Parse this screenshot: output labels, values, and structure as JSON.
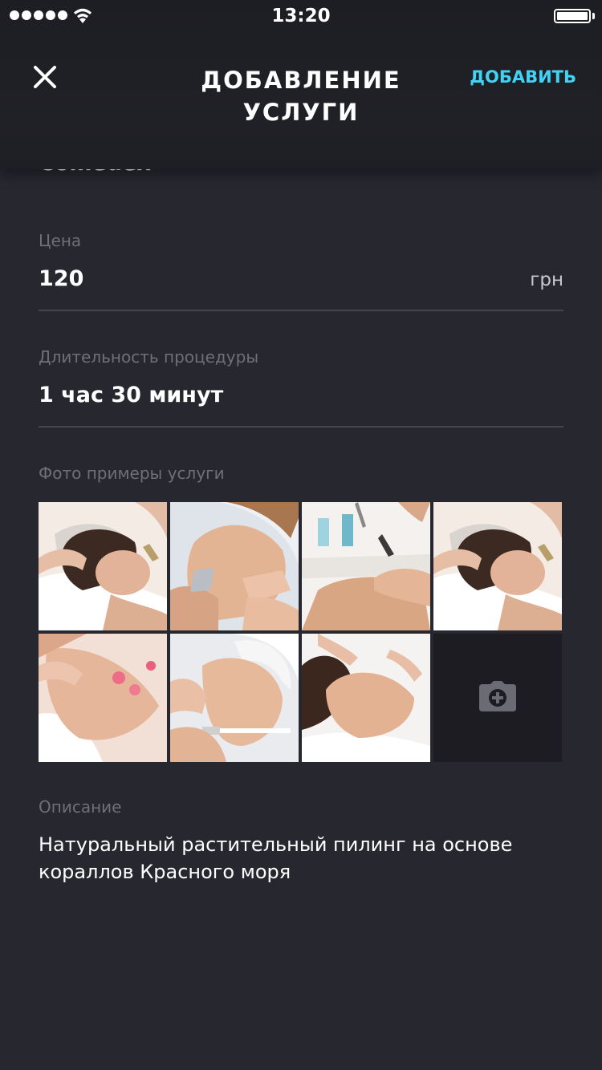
{
  "status_bar": {
    "time": "13:20",
    "signal_icon": "signal-dots-icon",
    "wifi_icon": "wifi-icon",
    "battery_icon": "battery-icon"
  },
  "nav": {
    "close_icon": "close-icon",
    "title": "ДОБАВЛЕНИЕ УСЛУГИ",
    "add_label": "ДОБАВИТЬ"
  },
  "form": {
    "partial_value": "Comedex",
    "price": {
      "label": "Цена",
      "value": "120",
      "unit": "грн"
    },
    "duration": {
      "label": "Длительность процедуры",
      "value": "1 час 30 минут"
    },
    "photos": {
      "label": "Фото примеры услуги",
      "items": [
        "photo-facial-massage",
        "photo-ultrasonic-cleaning",
        "photo-facial-cleansing",
        "photo-facial-massage",
        "photo-rose-petal-massage",
        "photo-peeling-brush",
        "photo-face-massage"
      ],
      "add_icon": "camera-add-icon"
    },
    "description": {
      "label": "Описание",
      "text": "Натуральный растительный пилинг на основе кораллов Красного моря"
    }
  },
  "colors": {
    "background": "#272730",
    "accent": "#41d3f5",
    "label": "#6f6f78",
    "divider": "#45454e"
  }
}
